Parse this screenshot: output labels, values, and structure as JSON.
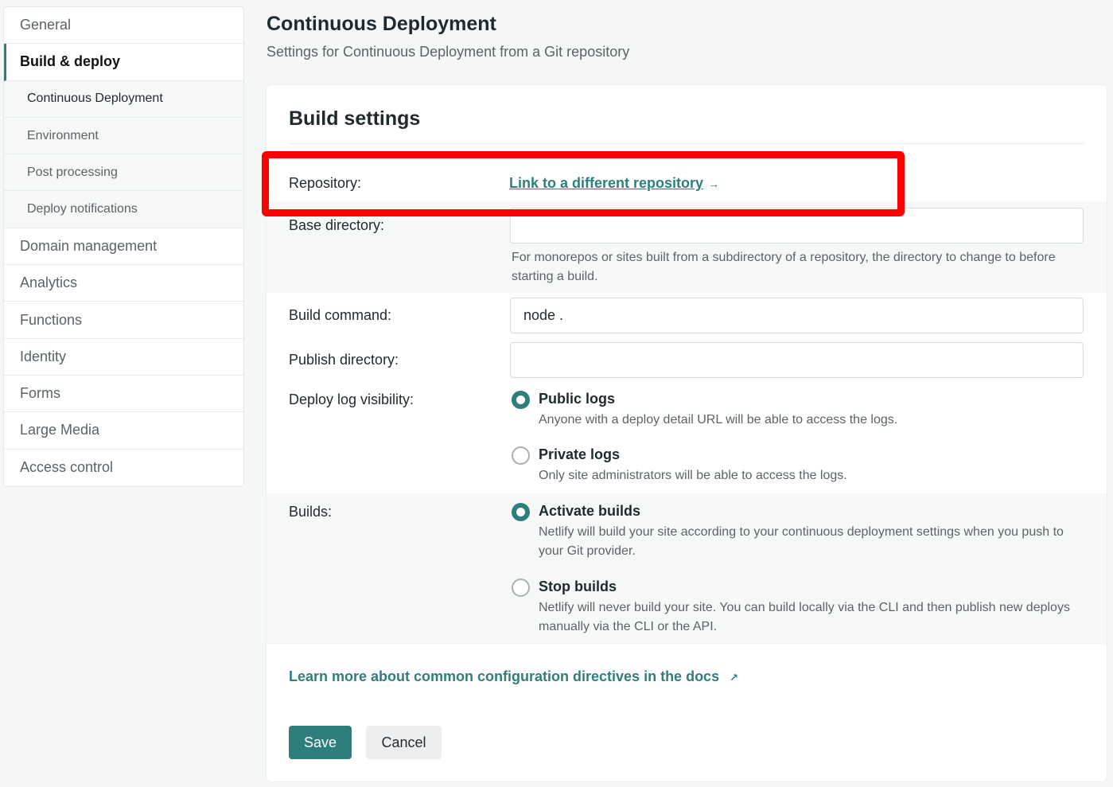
{
  "sidebar": {
    "items": [
      {
        "label": "General"
      },
      {
        "label": "Build & deploy"
      },
      {
        "label": "Domain management"
      },
      {
        "label": "Analytics"
      },
      {
        "label": "Functions"
      },
      {
        "label": "Identity"
      },
      {
        "label": "Forms"
      },
      {
        "label": "Large Media"
      },
      {
        "label": "Access control"
      }
    ],
    "subitems": [
      {
        "label": "Continuous Deployment"
      },
      {
        "label": "Environment"
      },
      {
        "label": "Post processing"
      },
      {
        "label": "Deploy notifications"
      }
    ]
  },
  "header": {
    "title": "Continuous Deployment",
    "subtitle": "Settings for Continuous Deployment from a Git repository"
  },
  "build_settings": {
    "title": "Build settings",
    "repository": {
      "label": "Repository:",
      "link": "Link to a different repository",
      "arrow": "→"
    },
    "base_directory": {
      "label": "Base directory:",
      "value": "",
      "help": "For monorepos or sites built from a subdirectory of a repository, the directory to change to before starting a build."
    },
    "build_command": {
      "label": "Build command:",
      "value": "node ."
    },
    "publish_directory": {
      "label": "Publish directory:",
      "value": ""
    },
    "deploy_log_visibility": {
      "label": "Deploy log visibility:",
      "options": [
        {
          "title": "Public logs",
          "desc": "Anyone with a deploy detail URL will be able to access the logs.",
          "checked": true
        },
        {
          "title": "Private logs",
          "desc": "Only site administrators will be able to access the logs.",
          "checked": false
        }
      ]
    },
    "builds": {
      "label": "Builds:",
      "options": [
        {
          "title": "Activate builds",
          "desc": "Netlify will build your site according to your continuous deployment settings when you push to your Git provider.",
          "checked": true
        },
        {
          "title": "Stop builds",
          "desc": "Netlify will never build your site. You can build locally via the CLI and then publish new deploys manually via the CLI or the API.",
          "checked": false
        }
      ]
    },
    "docs_link": "Learn more about common configuration directives in the docs",
    "docs_arrow": "↗",
    "save_label": "Save",
    "cancel_label": "Cancel"
  },
  "colors": {
    "accent": "#2e7f7c",
    "highlight": "#ff0000"
  }
}
